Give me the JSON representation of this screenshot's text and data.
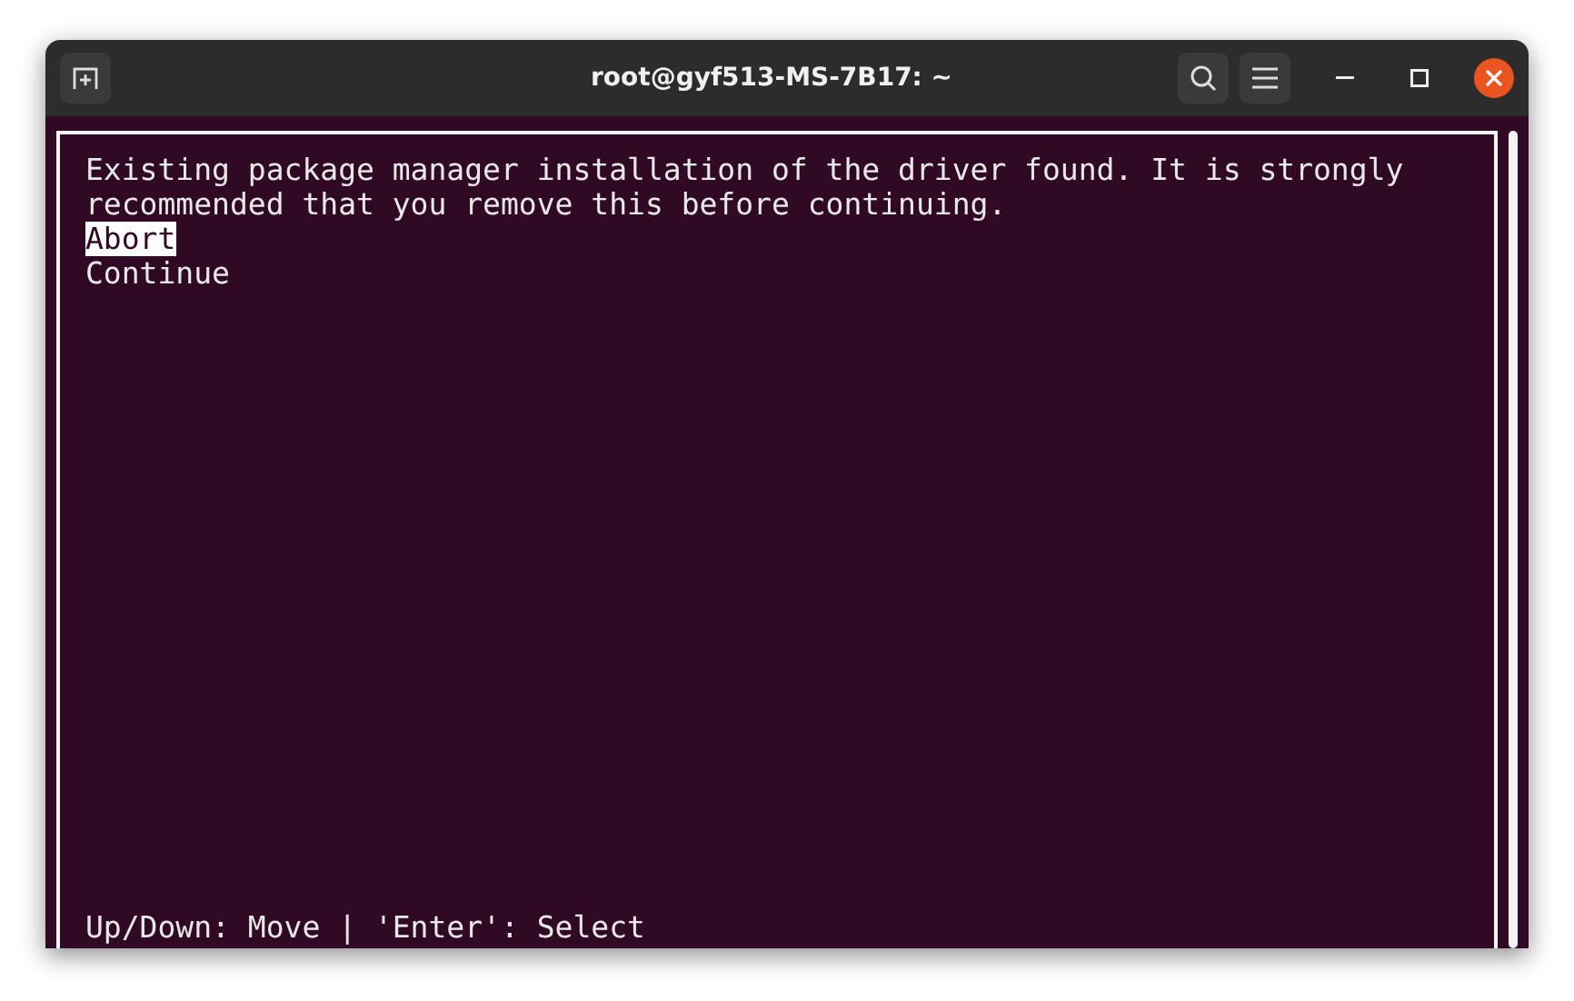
{
  "window": {
    "title": "root@gyf513-MS-7B17: ~"
  },
  "terminal": {
    "message_lines": [
      "Existing package manager installation of the driver found. It is strongly",
      "recommended that you remove this before continuing."
    ],
    "options": [
      {
        "label": "Abort",
        "selected": true
      },
      {
        "label": "Continue",
        "selected": false
      }
    ],
    "hint": "Up/Down: Move | 'Enter': Select"
  }
}
